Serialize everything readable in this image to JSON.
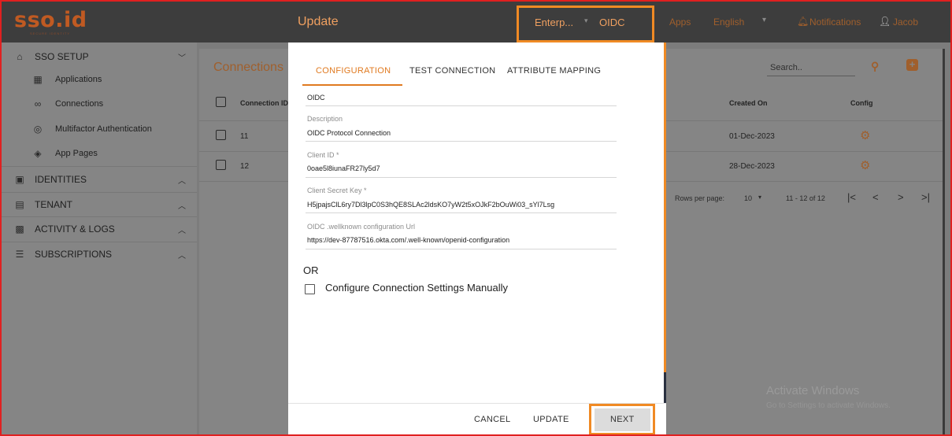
{
  "header": {
    "logo": "sso.id",
    "logo_tagline": "SECURE IDENTITY",
    "apps": "Apps",
    "language": "English",
    "notifications": "Notifications",
    "user": "Jacob"
  },
  "sidebar": {
    "sections": [
      {
        "label": "SSO SETUP",
        "icon": "home-icon",
        "chevron": "down"
      },
      {
        "label": "IDENTITIES",
        "icon": "id-badge-icon",
        "chevron": "up"
      },
      {
        "label": "TENANT",
        "icon": "tenant-icon",
        "chevron": "up"
      },
      {
        "label": "ACTIVITY & LOGS",
        "icon": "activity-icon",
        "chevron": "up"
      },
      {
        "label": "SUBSCRIPTIONS",
        "icon": "subscriptions-icon",
        "chevron": "up"
      }
    ],
    "sso_items": [
      {
        "label": "Applications",
        "icon": "grid-icon"
      },
      {
        "label": "Connections",
        "icon": "link-icon"
      },
      {
        "label": "Multifactor Authentication",
        "icon": "fingerprint-icon"
      },
      {
        "label": "App Pages",
        "icon": "layers-icon"
      }
    ]
  },
  "connections": {
    "title": "Connections",
    "search_placeholder": "Search..",
    "columns": [
      "Connection ID",
      "Created On",
      "Config"
    ],
    "rows": [
      {
        "id": "11",
        "created": "01-Dec-2023"
      },
      {
        "id": "12",
        "created": "28-Dec-2023"
      }
    ],
    "pagination": {
      "rows_label": "Rows per page:",
      "rows_value": "10",
      "range": "11 - 12 of 12"
    }
  },
  "dialog": {
    "title": "Update",
    "selects": [
      "Enterp...",
      "OIDC"
    ],
    "tabs": [
      "CONFIGURATION",
      "TEST CONNECTION",
      "ATTRIBUTE MAPPING"
    ],
    "active_tab": "CONFIGURATION",
    "fields": {
      "protocol": {
        "value": "OIDC"
      },
      "description": {
        "label": "Description",
        "value": "OIDC Protocol Connection"
      },
      "client_id": {
        "label": "Client ID *",
        "value": "0oae5l8iunaFR27ly5d7"
      },
      "client_secret": {
        "label": "Client Secret Key *",
        "value": "H5jpajsClL6ry7Dl3lpC0S3hQE8SLAc2ldsKO7yW2t5xOJkF2bOuWi03_sYl7Lsg"
      },
      "wellknown": {
        "label": "OIDC .wellknown configuration Url",
        "value": "https://dev-87787516.okta.com/.well-known/openid-configuration"
      }
    },
    "or_text": "OR",
    "manual_label": "Configure Connection Settings Manually",
    "buttons": {
      "cancel": "CANCEL",
      "update": "UPDATE",
      "next": "NEXT"
    }
  },
  "watermark": {
    "title": "Activate Windows",
    "subtitle": "Go to Settings to activate Windows."
  },
  "colors": {
    "accent": "#e07a20",
    "highlight_box": "#f08a24",
    "frame": "#e02020",
    "topbar": "#3d3d3d"
  }
}
